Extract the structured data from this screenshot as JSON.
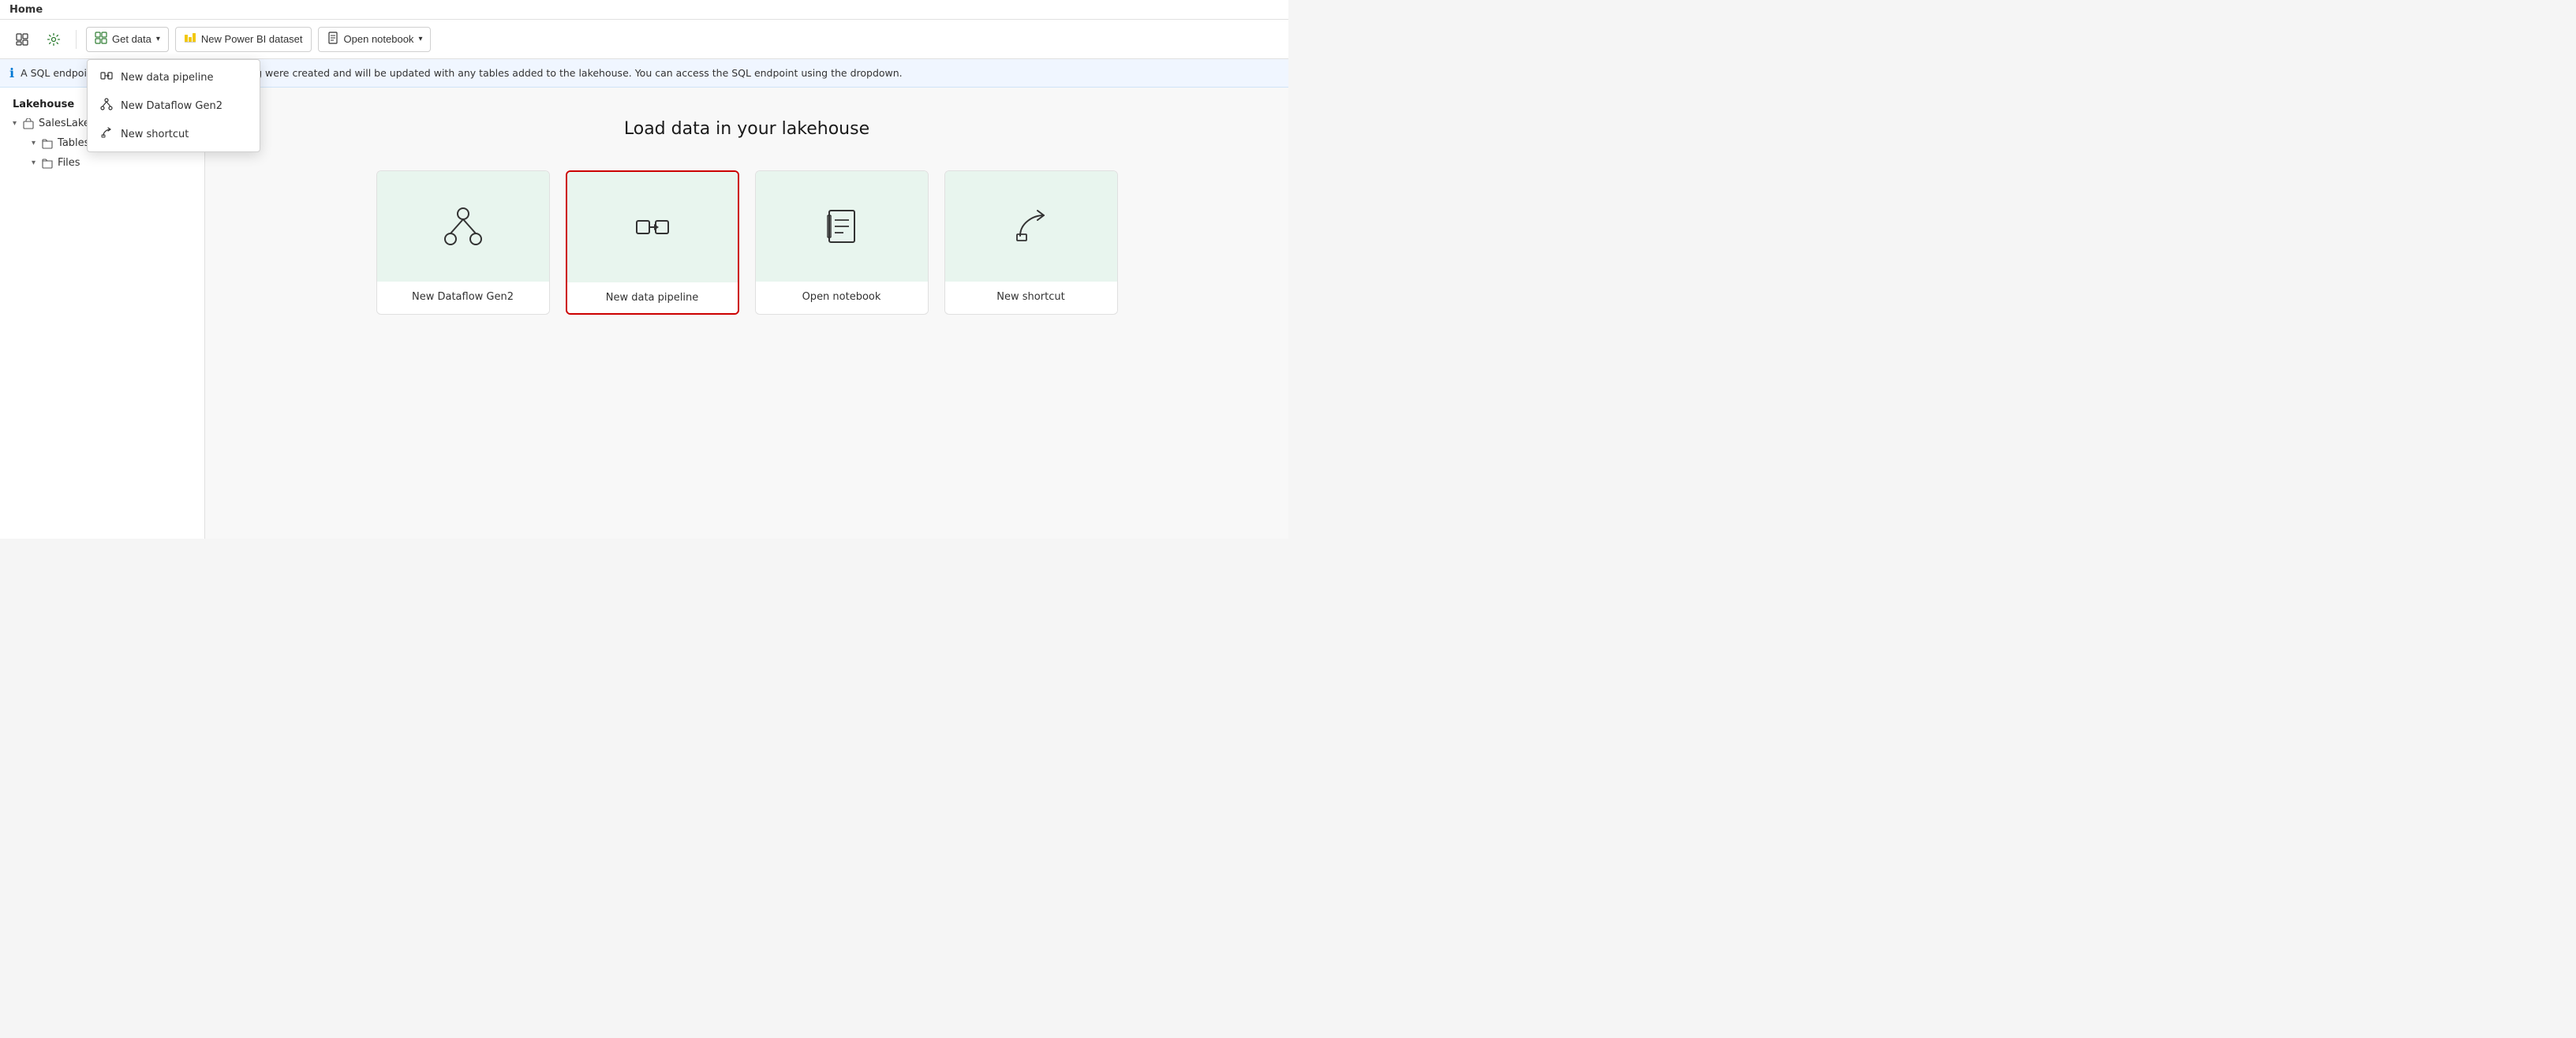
{
  "window": {
    "title": "Home"
  },
  "toolbar": {
    "new_item_label": "New item",
    "get_data_label": "Get data",
    "new_power_bi_label": "New Power BI dataset",
    "open_notebook_label": "Open notebook"
  },
  "dropdown": {
    "items": [
      {
        "id": "new-data-pipeline",
        "label": "New data pipeline"
      },
      {
        "id": "new-dataflow-gen2",
        "label": "New Dataflow Gen2"
      },
      {
        "id": "new-shortcut",
        "label": "New shortcut"
      }
    ]
  },
  "info_bar": {
    "message": "A SQL endpoint and default dataset for reporting were created and will be updated with any tables added to the lakehouse. You can access the SQL endpoint using the dropdown."
  },
  "sidebar": {
    "section_title": "Lakehouse",
    "tree_items": [
      {
        "id": "sales-lakehouse",
        "label": "SalesLakehouse",
        "level": 0,
        "expanded": true
      },
      {
        "id": "tables",
        "label": "Tables",
        "level": 1,
        "expanded": false
      },
      {
        "id": "files",
        "label": "Files",
        "level": 1,
        "expanded": false
      }
    ]
  },
  "content": {
    "heading": "Load data in your lakehouse",
    "cards": [
      {
        "id": "new-dataflow-gen2",
        "label": "New Dataflow Gen2",
        "icon": "dataflow",
        "highlighted": false
      },
      {
        "id": "new-data-pipeline",
        "label": "New data pipeline",
        "icon": "pipeline",
        "highlighted": true
      },
      {
        "id": "open-notebook",
        "label": "Open notebook",
        "icon": "notebook",
        "highlighted": false
      },
      {
        "id": "new-shortcut",
        "label": "New shortcut",
        "icon": "shortcut",
        "highlighted": false
      }
    ]
  },
  "icons": {
    "dataflow": "⑂",
    "pipeline": "⊟",
    "notebook": "📓",
    "shortcut": "⤴"
  }
}
